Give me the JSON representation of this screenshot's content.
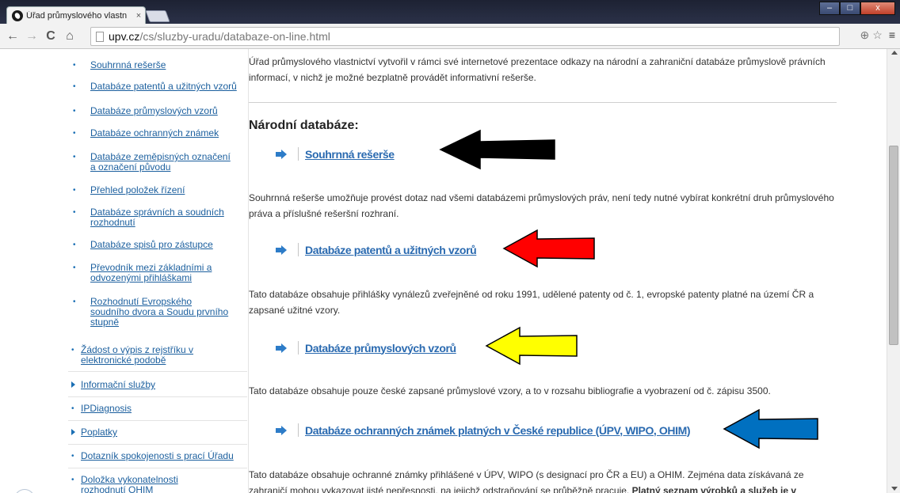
{
  "browser": {
    "tab_title": "Úřad průmyslového vlastn",
    "tab_close": "×",
    "url_host": "upv.cz",
    "url_path": "/cs/sluzby-uradu/databaze-on-line.html",
    "back": "←",
    "forward": "→",
    "reload": "C",
    "home": "⌂",
    "zoom": "⊕",
    "star": "☆",
    "menu": "≡",
    "minimize": "–",
    "maximize": "□",
    "close": "x"
  },
  "sidebar": {
    "items": [
      {
        "label": "Souhrnná rešerše",
        "type": "sub"
      },
      {
        "label": "Databáze patentů a užitných vzorů",
        "type": "sub"
      },
      {
        "label": "Databáze průmyslových vzorů",
        "type": "sub"
      },
      {
        "label": "Databáze ochranných známek",
        "type": "sub"
      },
      {
        "label": "Databáze zeměpisných označení a označení původu",
        "type": "sub"
      },
      {
        "label": "Přehled položek řízení",
        "type": "sub"
      },
      {
        "label": "Databáze správních a soudních rozhodnutí",
        "type": "sub"
      },
      {
        "label": "Databáze spisů pro zástupce",
        "type": "sub"
      },
      {
        "label": "Převodník mezi základními a odvozenými přihláškami",
        "type": "sub"
      },
      {
        "label": "Rozhodnutí Evropského soudního dvora a Soudu prvního stupně",
        "type": "sub"
      },
      {
        "label": "Žádost o výpis z rejstříku v elektronické podobě",
        "type": "top"
      },
      {
        "label": "Informační služby",
        "type": "top-expand"
      },
      {
        "label": "IPDiagnosis",
        "type": "top"
      },
      {
        "label": "Poplatky",
        "type": "top-expand"
      },
      {
        "label": "Dotazník spokojenosti s prací Úřadu",
        "type": "top"
      },
      {
        "label": "Doložka vykonatelnosti rozhodnutí OHIM",
        "type": "top"
      }
    ]
  },
  "content": {
    "intro": "Úřad průmyslového vlastnictví vytvořil v rámci své internetové prezentace odkazy na národní a zahraniční databáze průmyslově právních informací, v nichž je možné bezplatně provádět informativní rešerše.",
    "section_title": "Národní databáze:",
    "databases": [
      {
        "link": "Souhrnná rešerše",
        "desc": "Souhrnná  rešerše umožňuje provést dotaz nad všemi databázemi průmyslových práv, není tedy nutné vybírat konkrétní druh průmyslového práva a příslušné rešeršní rozhraní."
      },
      {
        "link": "Databáze patentů a užitných vzorů",
        "desc": "Tato databáze obsahuje přihlášky vynálezů zveřejněné od roku 1991, udělené patenty od č. 1, evropské patenty platné na území ČR a zapsané užitné vzory."
      },
      {
        "link": "Databáze průmyslových vzorů",
        "desc": "Tato databáze obsahuje pouze české zapsané průmyslové vzory, a to v rozsahu bibliografie a vyobrazení od č. zápisu 3500."
      },
      {
        "link": "Databáze ochranných známek platných v České republice (ÚPV, WIPO, OHIM)",
        "desc": "Tato databáze obsahuje ochranné známky přihlášené v ÚPV, WIPO (s designací pro ČR a EU) a OHIM. Zejména data získávaná ze zahraničí mohou vykazovat jisté nepřesnosti, na jejichž odstraňování se průběžně pracuje.",
        "desc_bold": "Platný seznam výrobků a služeb je v"
      }
    ]
  },
  "annotation_colors": [
    "#000000",
    "#ff0000",
    "#ffff00",
    "#0070c0"
  ]
}
